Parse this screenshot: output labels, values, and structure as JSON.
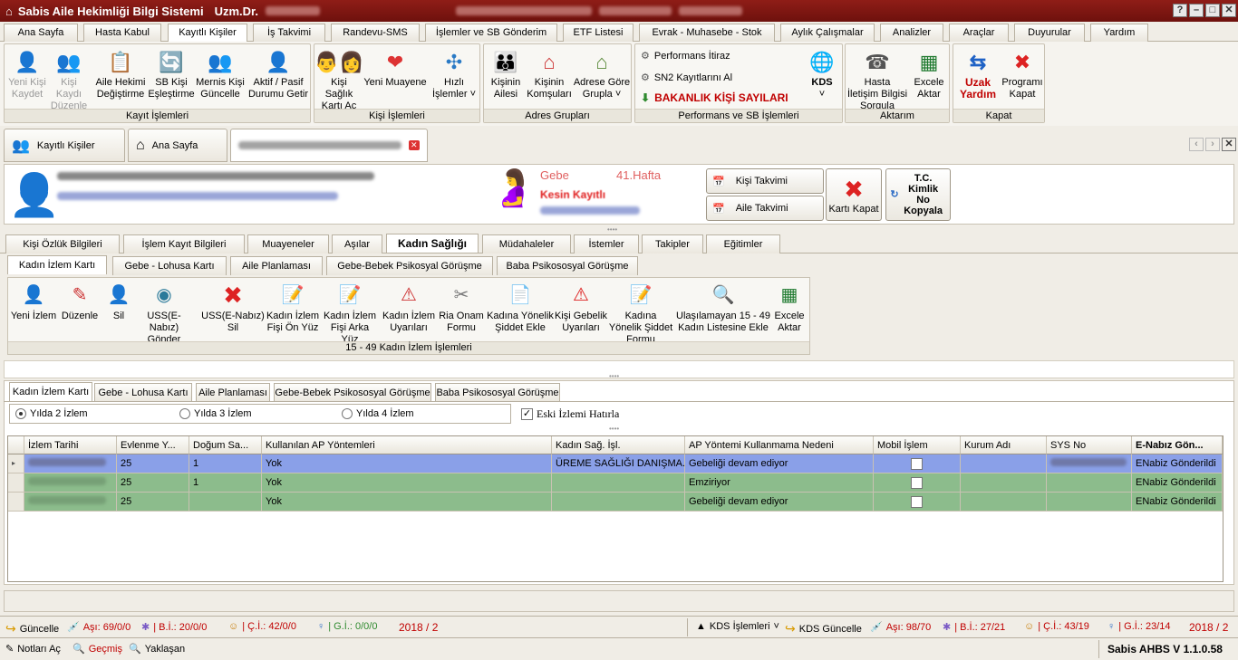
{
  "window": {
    "title": "Sabis Aile Hekimliği Bilgi Sistemi",
    "user_prefix": "Uzm.Dr."
  },
  "menu_tabs": [
    "Ana Sayfa",
    "Hasta Kabul",
    "Kayıtlı Kişiler",
    "İş Takvimi",
    "Randevu-SMS",
    "İşlemler ve SB Gönderim",
    "ETF Listesi",
    "Evrak - Muhasebe - Stok",
    "Aylık Çalışmalar",
    "Analizler",
    "Araçlar",
    "Duyurular",
    "Yardım"
  ],
  "ribbon": {
    "kayit": {
      "label": "Kayıt İşlemleri",
      "buttons": [
        "Yeni Kişi Kaydet",
        "Kişi Kaydı Düzenle",
        "Aile Hekimi Değiştirme",
        "SB Kişi Eşleştirme",
        "Mernis Kişi Güncelle",
        "Aktif / Pasif Durumu Getir"
      ]
    },
    "kisi": {
      "label": "Kişi İşlemleri",
      "buttons": [
        "Kişi Sağlık Kartı Aç",
        "Yeni Muayene",
        "Hızlı İşlemler"
      ]
    },
    "adres": {
      "label": "Adres Grupları",
      "buttons": [
        "Kişinin Ailesi",
        "Kişinin Komşuları",
        "Adrese Göre Grupla"
      ]
    },
    "performans": {
      "label": "Performans ve SB İşlemleri",
      "items": [
        "Performans İtiraz",
        "SN2 Kayıtlarını Al",
        "BAKANLIK KİŞİ SAYILARI"
      ],
      "kds": "KDS"
    },
    "aktarim": {
      "label": "Aktarım",
      "buttons": [
        "Hasta İletişim Bilgisi Sorgula",
        "Excele Aktar"
      ]
    },
    "kapat": {
      "label": "Kapat",
      "buttons": [
        "Uzak Yardım",
        "Programı Kapat"
      ]
    }
  },
  "doc_tabs": [
    "Kayıtlı Kişiler",
    "Ana Sayfa"
  ],
  "patient": {
    "status1": "Gebe",
    "status2": "41.Hafta",
    "status3": "Kesin Kayıtlı",
    "btn_kisi_takvimi": "Kişi Takvimi",
    "btn_aile_takvimi": "Aile Takvimi",
    "btn_kart_kapat": "Kartı Kapat",
    "btn_tc": "T.C. Kimlik No Kopyala"
  },
  "main_tabs": [
    "Kişi Özlük Bilgileri",
    "İşlem Kayıt Bilgileri",
    "Muayeneler",
    "Aşılar",
    "Kadın Sağlığı",
    "Müdahaleler",
    "İstemler",
    "Takipler",
    "Eğitimler"
  ],
  "sub_tabs": [
    "Kadın İzlem Kartı",
    "Gebe - Lohusa Kartı",
    "Aile Planlaması",
    "Gebe-Bebek Psikosyal Görüşme",
    "Baba Psikososyal Görüşme"
  ],
  "toolbar": {
    "label": "15 - 49 Kadın İzlem İşlemleri",
    "buttons": [
      "Yeni İzlem",
      "Düzenle",
      "Sil",
      "USS(E-Nabız) Gönder",
      "USS(E-Nabız) Sil",
      "Kadın İzlem Fişi Ön Yüz",
      "Kadın İzlem Fişi Arka Yüz",
      "Kadın İzlem Uyarıları",
      "Ria Onam Formu",
      "Kadına Yönelik Şiddet Ekle",
      "Kişi Gebelik Uyarıları",
      "Kadına Yönelik Şiddet Formu",
      "Ulaşılamayan 15 - 49 Kadın Listesine Ekle",
      "Excele Aktar"
    ]
  },
  "lower_tabs": [
    "Kadın İzlem Kartı",
    "Gebe - Lohusa Kartı",
    "Aile Planlaması",
    "Gebe-Bebek Psikososyal Görüşme",
    "Baba Psikososyal Görüşme"
  ],
  "radios": {
    "r1": "Yılda 2 İzlem",
    "r2": "Yılda 3 İzlem",
    "r3": "Yılda 4 İzlem",
    "selected": "Yılda 2 İzlem",
    "checkbox": "Eski İzlemi Hatırla"
  },
  "grid": {
    "columns": [
      "İzlem Tarihi",
      "Evlenme Y...",
      "Doğum Sa...",
      "Kullanılan AP Yöntemleri",
      "Kadın Sağ. İşl.",
      "AP Yöntemi Kullanmama Nedeni",
      "Mobil İşlem",
      "Kurum Adı",
      "SYS No",
      "E-Nabız Gön..."
    ],
    "rows": [
      {
        "evlenme": "25",
        "dogum": "1",
        "ap": "Yok",
        "kadin": "ÜREME SAĞLIĞI DANIŞMA...",
        "neden": "Gebeliği devam ediyor",
        "enabiz": "ENabiz Gönderildi",
        "color": "#8aa0e8"
      },
      {
        "evlenme": "25",
        "dogum": "1",
        "ap": "Yok",
        "kadin": "",
        "neden": "Emziriyor",
        "enabiz": "ENabiz Gönderildi",
        "color": "#8cbc8c"
      },
      {
        "evlenme": "25",
        "dogum": "",
        "ap": "Yok",
        "kadin": "",
        "neden": "Gebeliği devam ediyor",
        "enabiz": "ENabiz Gönderildi",
        "color": "#8cbc8c"
      }
    ]
  },
  "status1": {
    "guncelle": "Güncelle",
    "asi": "Aşı: 69/0/0",
    "bi": "| B.İ.: 20/0/0",
    "ci": "| Ç.İ.: 42/0/0",
    "gi": "| G.İ.: 0/0/0",
    "date": "2018 / 2",
    "kds": "KDS İşlemleri",
    "kds_guncelle": "KDS Güncelle",
    "asi2": "Aşı: 98/70",
    "bi2": "| B.İ.: 27/21",
    "ci2": "| Ç.İ.: 43/19",
    "gi2": "| G.İ.: 23/14",
    "date2": "2018 / 2"
  },
  "status2": {
    "notlar": "Notları Aç",
    "gecmis": "Geçmiş",
    "yaklasan": "Yaklaşan",
    "version": "Sabis AHBS V 1.1.0.58"
  }
}
